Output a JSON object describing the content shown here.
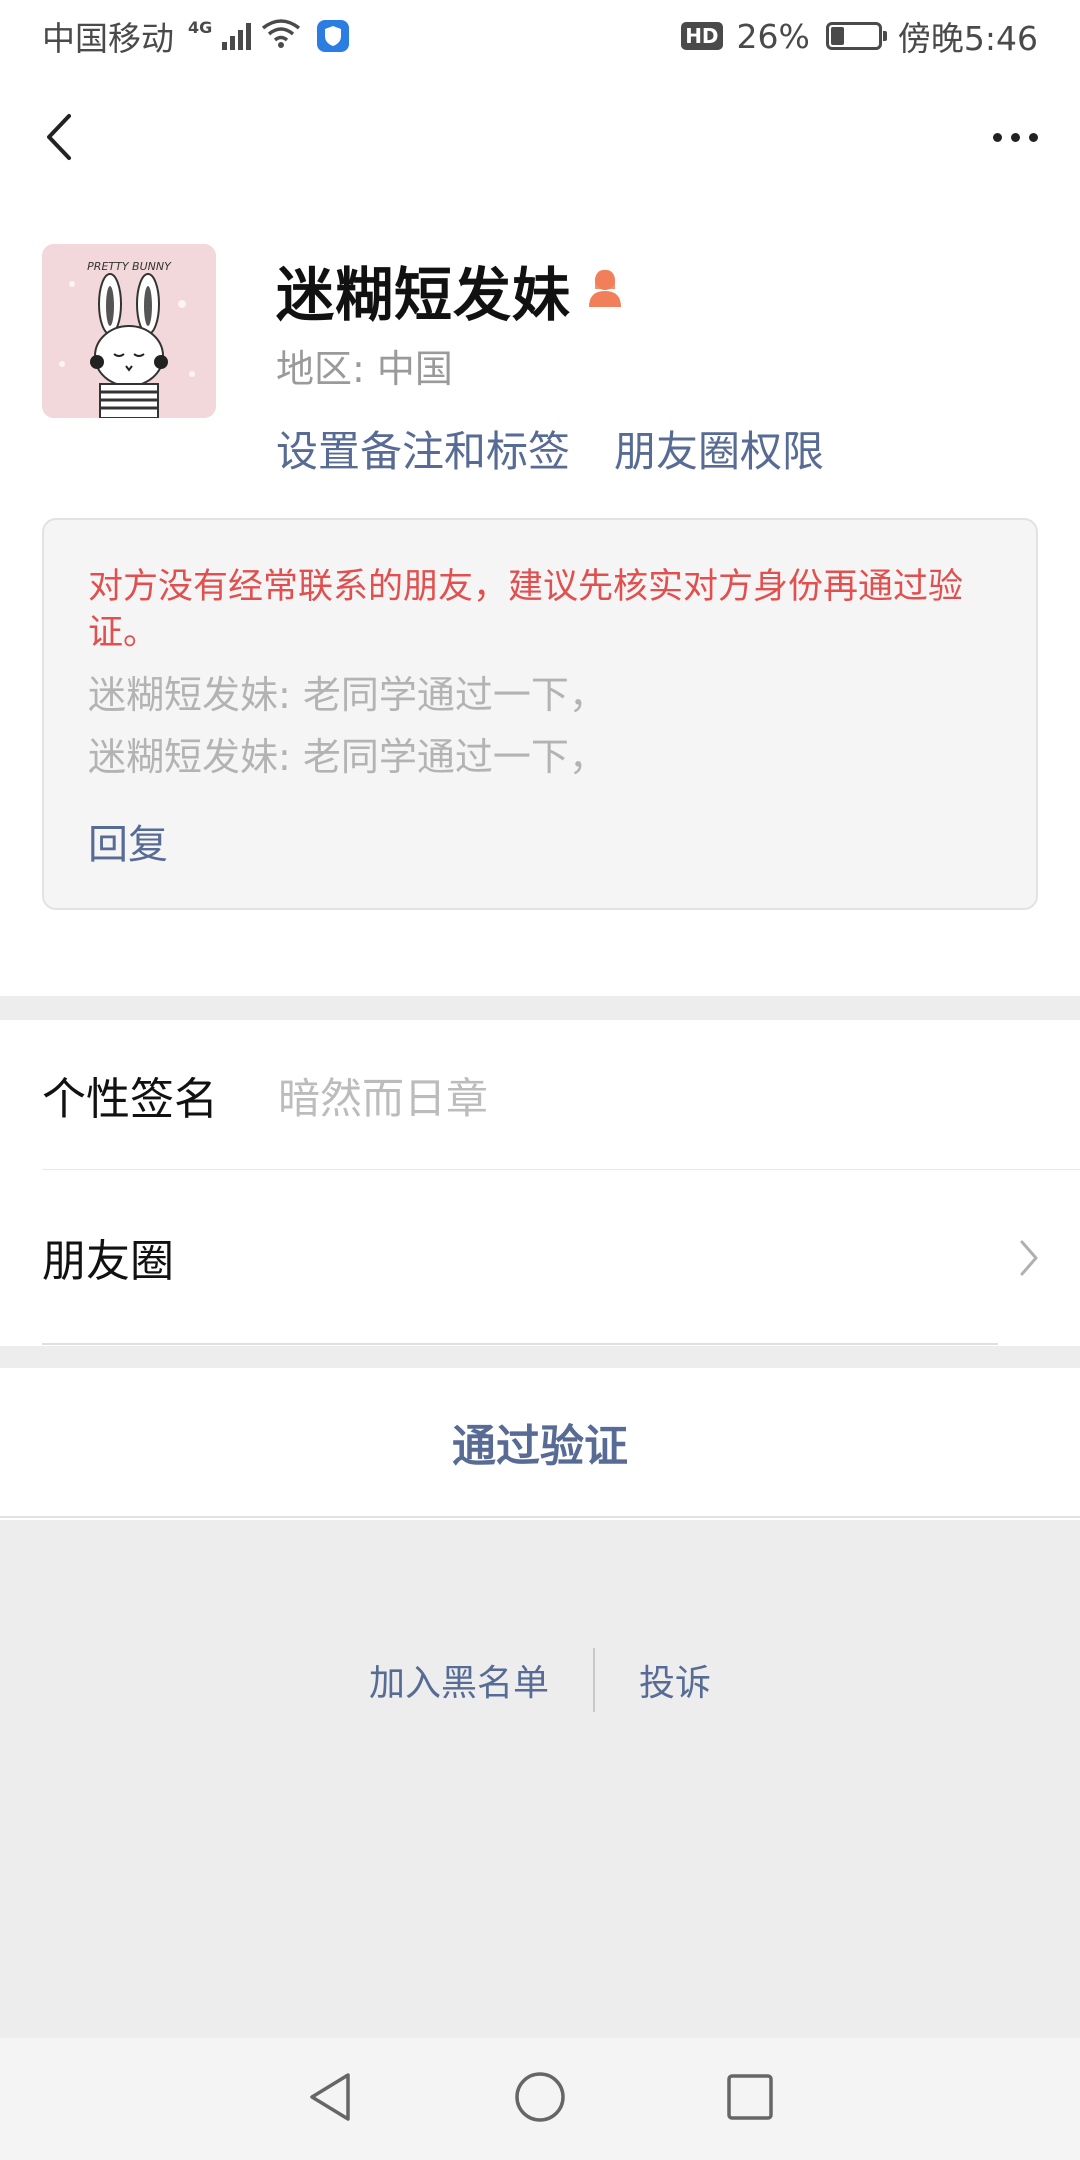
{
  "status_bar": {
    "carrier": "中国移动",
    "network": "4G",
    "hd": "HD",
    "battery": "26%",
    "battery_level": 0.26,
    "time": "傍晚5:46"
  },
  "nav": {
    "back_icon": "chevron-left-icon",
    "more_icon": "more-dots-icon"
  },
  "profile": {
    "name": "迷糊短发妹",
    "gender_icon": "female-user-icon",
    "region_label": "地区:",
    "region_value": "中国",
    "set_remark": "设置备注和标签",
    "moments_permission": "朋友圈权限",
    "avatar_text": "PRETTY BUNNY"
  },
  "verification": {
    "warning": "对方没有经常联系的朋友，建议先核实对方身份再通过验证。",
    "messages": [
      "迷糊短发妹: 老同学通过一下，",
      "迷糊短发妹: 老同学通过一下，"
    ],
    "reply": "回复"
  },
  "rows": {
    "signature_label": "个性签名",
    "signature_value": "暗然而日章",
    "moments_label": "朋友圈"
  },
  "approve_button": "通过验证",
  "actions": {
    "blacklist": "加入黑名单",
    "report": "投诉"
  },
  "colors": {
    "link": "#576b95",
    "warning": "#e1504f",
    "background_gray": "#ededed"
  }
}
